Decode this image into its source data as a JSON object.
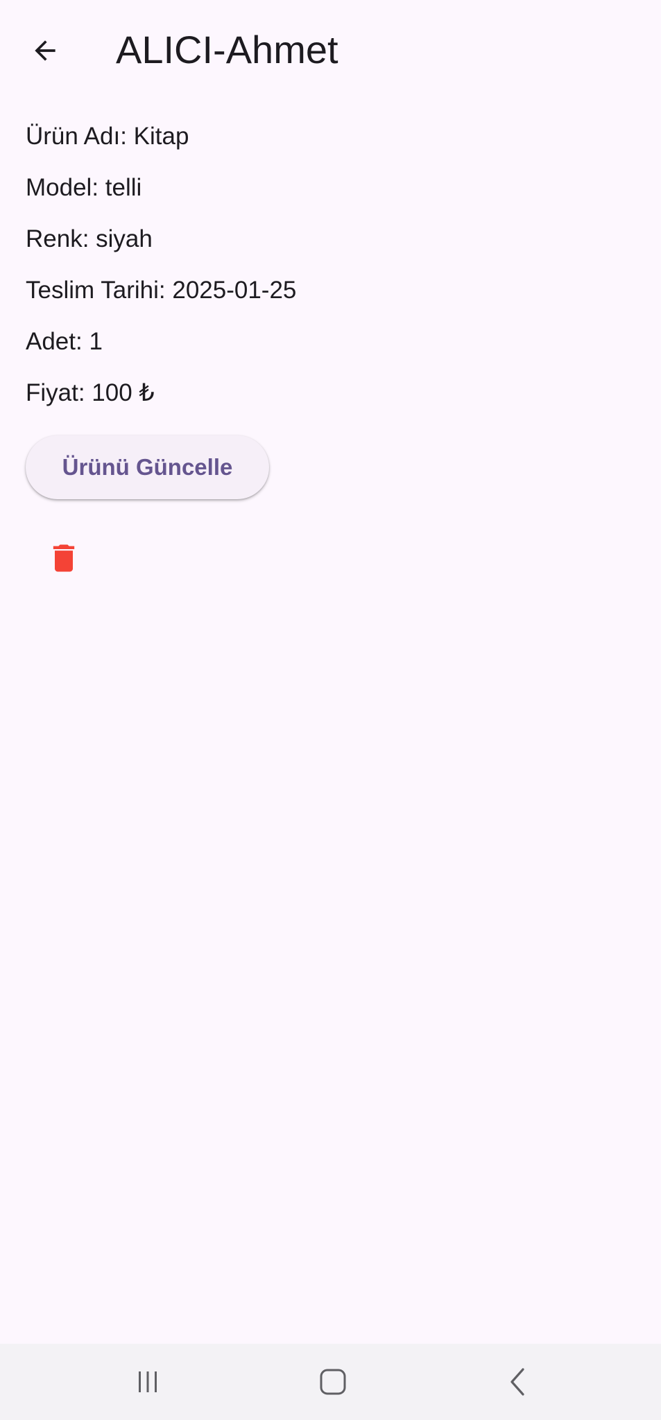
{
  "app_bar": {
    "title": "ALICI-Ahmet",
    "back_icon": "arrow-left-icon"
  },
  "details": [
    {
      "text": "Ürün Adı: Kitap"
    },
    {
      "text": "Model: telli"
    },
    {
      "text": "Renk: siyah"
    },
    {
      "text": "Teslim Tarihi: 2025-01-25"
    },
    {
      "text": "Adet: 1"
    },
    {
      "text": "Fiyat: 100 ₺"
    }
  ],
  "actions": {
    "update_label": "Ürünü Güncelle",
    "delete_icon": "trash-icon"
  },
  "system_nav": {
    "recents_icon": "recents-icon",
    "home_icon": "home-icon",
    "back_icon": "back-chevron-icon"
  },
  "colors": {
    "background": "#fdf7fe",
    "primary": "#65558f",
    "button_surface": "#f6eff8",
    "delete": "#f44336",
    "nav_bar": "#f3f2f5"
  }
}
